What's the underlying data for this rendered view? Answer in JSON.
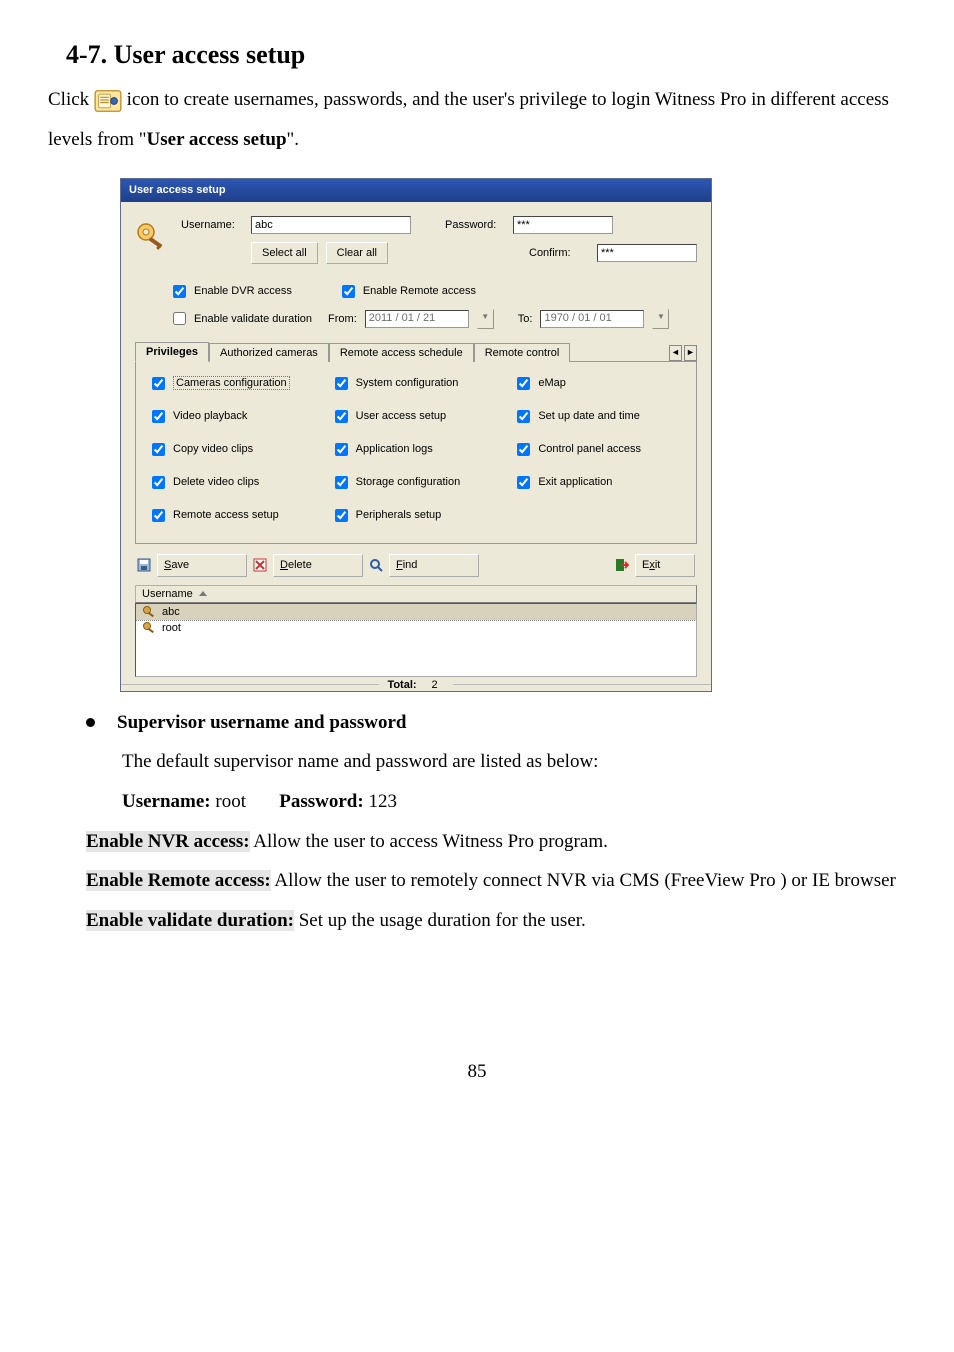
{
  "doc": {
    "heading": "4-7.  User access setup",
    "intro_prefix": "Click ",
    "intro_suffix": " icon to create usernames, passwords, and the user's privilege to login Witness Pro in different access levels from \"",
    "intro_bold": "User access setup",
    "intro_end": "\".",
    "page_num": "85"
  },
  "dialog": {
    "title": "User access setup",
    "username_label": "Username:",
    "username_value": "abc",
    "password_label": "Password:",
    "password_value": "***",
    "confirm_label": "Confirm:",
    "confirm_value": "***",
    "select_all": "Select all",
    "clear_all": "Clear all",
    "enable_dvr": "Enable DVR access",
    "enable_remote": "Enable Remote access",
    "enable_validate": "Enable validate duration",
    "from_label": "From:",
    "from_value": "2011 / 01 / 21",
    "to_label": "To:",
    "to_value": "1970 / 01 / 01",
    "tabs": {
      "privileges": "Privileges",
      "authorized_cameras": "Authorized cameras",
      "remote_schedule": "Remote access schedule",
      "remote_control": "Remote control"
    },
    "priv": {
      "cameras_config": "Cameras configuration",
      "system_config": "System configuration",
      "emap": "eMap",
      "video_playback": "Video playback",
      "user_access": "User access setup",
      "date_time": "Set up date and time",
      "copy_clips": "Copy video clips",
      "app_logs": "Application logs",
      "panel_access": "Control panel access",
      "delete_clips": "Delete video clips",
      "storage_config": "Storage configuration",
      "exit_app": "Exit application",
      "remote_setup": "Remote access setup",
      "periph_setup": "Peripherals setup"
    },
    "actions": {
      "save": "Save",
      "delete": "Delete",
      "find": "Find",
      "exit": "Exit"
    },
    "list": {
      "header": "Username",
      "user1": "abc",
      "user2": "root"
    },
    "total_label": "Total:",
    "total_value": "2"
  },
  "below": {
    "supervisor_heading": "Supervisor username and password",
    "default_line": "The default supervisor name and password are listed as below:",
    "username_lbl": "Username:",
    "username_val": " root",
    "password_lbl": "Password:",
    "password_val": " 123",
    "enable_nvr_lbl": "Enable NVR access:",
    "enable_nvr_txt": " Allow the user to access Witness Pro program.",
    "enable_remote_lbl": "Enable Remote access:",
    "enable_remote_txt": " Allow the user to remotely connect NVR via CMS (FreeView Pro ) or IE browser",
    "enable_validate_lbl": "Enable validate duration:",
    "enable_validate_txt": " Set up the usage duration for the user."
  }
}
